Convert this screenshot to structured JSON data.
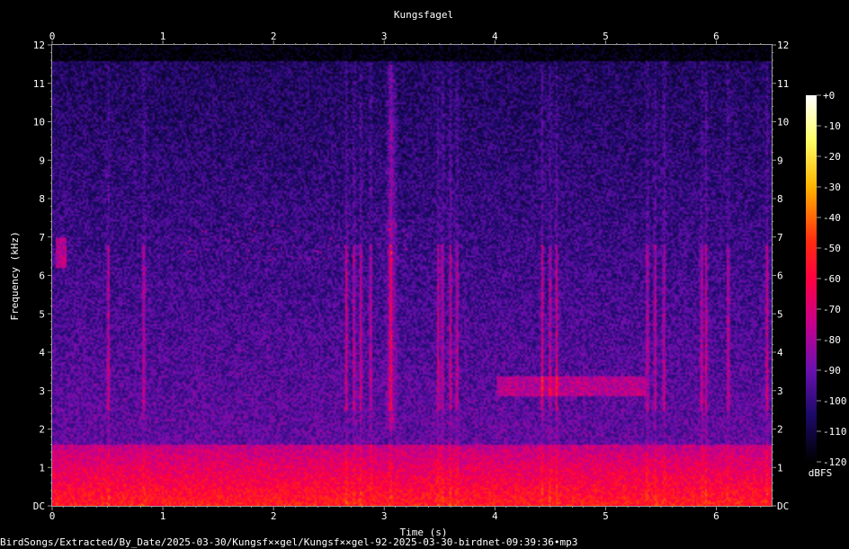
{
  "chart_data": {
    "type": "heatmap",
    "title": "Kungsfagel",
    "xlabel": "Time (s)",
    "ylabel": "Frequency (kHz)",
    "x_ticks": [
      "0",
      "1",
      "2",
      "3",
      "4",
      "5",
      "6"
    ],
    "y_ticks": [
      "DC",
      "1",
      "2",
      "3",
      "4",
      "5",
      "6",
      "7",
      "8",
      "9",
      "10",
      "11",
      "12"
    ],
    "xlim": [
      0,
      6.5
    ],
    "ylim": [
      0,
      12
    ],
    "colorbar": {
      "label": "dBFS",
      "ticks": [
        "+0",
        "-10",
        "-20",
        "-30",
        "-40",
        "-50",
        "-60",
        "-70",
        "-80",
        "-90",
        "-100",
        "-110",
        "-120"
      ],
      "range": [
        -120,
        0
      ]
    }
  },
  "footer": {
    "path": "BirdSongs/Extracted/By_Date/2025-03-30/Kungsf××gel/Kungsf××gel-92-2025-03-30-birdnet-09:39:36•mp3"
  }
}
